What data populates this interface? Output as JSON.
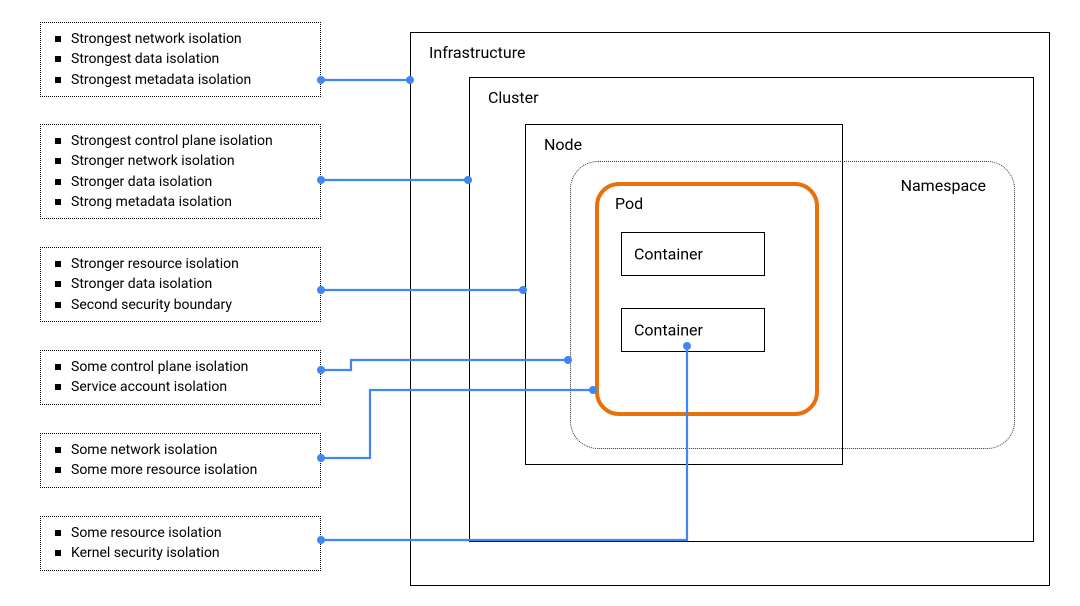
{
  "iso_boxes": [
    {
      "items": [
        "Strongest network isolation",
        "Strongest data isolation",
        "Strongest metadata isolation"
      ]
    },
    {
      "items": [
        "Strongest control plane isolation",
        "Stronger network isolation",
        "Stronger data isolation",
        "Strong metadata isolation"
      ]
    },
    {
      "items": [
        "Stronger resource isolation",
        "Stronger data isolation",
        "Second security boundary"
      ]
    },
    {
      "items": [
        "Some control plane isolation",
        "Service account isolation"
      ]
    },
    {
      "items": [
        "Some network isolation",
        "Some more resource isolation"
      ]
    },
    {
      "items": [
        "Some resource isolation",
        "Kernel security isolation"
      ]
    }
  ],
  "labels": {
    "infrastructure": "Infrastructure",
    "cluster": "Cluster",
    "node": "Node",
    "namespace": "Namespace",
    "pod": "Pod",
    "container1": "Container",
    "container2": "Container"
  }
}
